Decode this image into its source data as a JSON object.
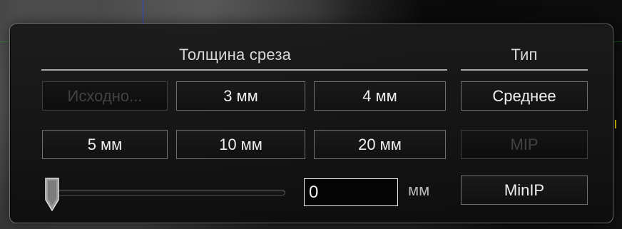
{
  "panel": {
    "thickness_title": "Толщина среза",
    "type_title": "Тип",
    "thickness_buttons": [
      {
        "label": "Исходно...",
        "state": "disabled"
      },
      {
        "label": "3 мм",
        "state": "enabled"
      },
      {
        "label": "4 мм",
        "state": "enabled"
      },
      {
        "label": "5 мм",
        "state": "enabled"
      },
      {
        "label": "10 мм",
        "state": "enabled"
      },
      {
        "label": "20 мм",
        "state": "enabled"
      }
    ],
    "type_buttons": [
      {
        "label": "Среднее",
        "state": "enabled"
      },
      {
        "label": "MIP",
        "state": "disabled"
      },
      {
        "label": "MinIP",
        "state": "enabled"
      }
    ],
    "slider": {
      "value": 0,
      "icon": "slider-thumb-icon"
    },
    "value_input": {
      "value": "0"
    },
    "unit": "мм"
  },
  "colors": {
    "panel_bg": "#161616",
    "border": "#707070",
    "text": "#efefef",
    "muted_text": "#424242",
    "accent": "#ffffff"
  }
}
